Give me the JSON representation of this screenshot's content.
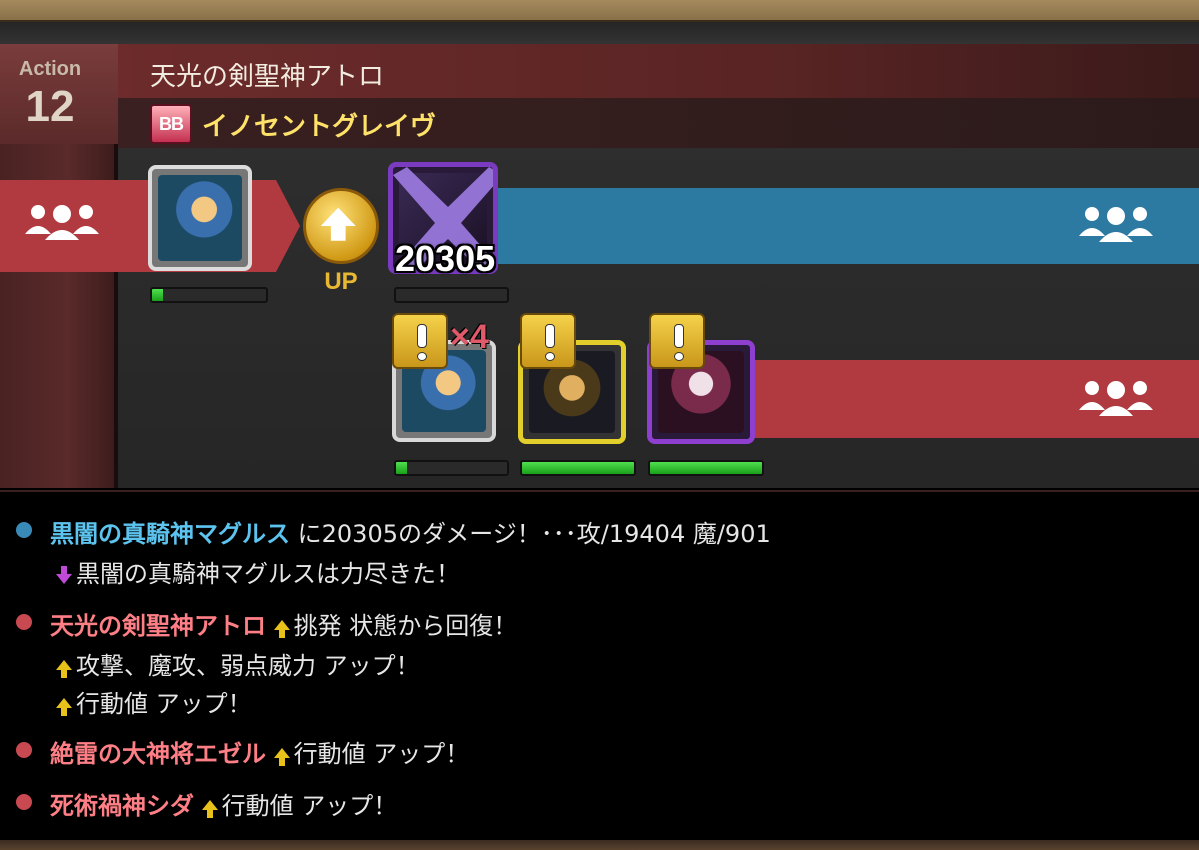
{
  "colors": {
    "ally_band": "#b03a40",
    "enemy_band": "#2c7aa1",
    "hp_fill": "#2fc02f",
    "ally_dot": "#c84a50",
    "enemy_dot": "#3a8ab8"
  },
  "header": {
    "action_label": "Action",
    "action_number": "12",
    "unit_name": "天光の剣聖神アトロ",
    "skill_badge": "BB",
    "skill_name": "イノセントグレイヴ"
  },
  "battle": {
    "up_label": "UP",
    "damage": "20305",
    "multiplier": "×4",
    "hp": {
      "actor": 0.1,
      "target": 0.0,
      "ally_a": 0.1,
      "ally_b": 1.0,
      "ally_c": 1.0
    },
    "icons": {
      "ally_group": "party-icon",
      "enemy_group": "party-icon",
      "up": "arrow-up-icon",
      "defeated": "x-mark-icon",
      "warning": "exclamation-icon"
    }
  },
  "log": [
    {
      "side": "enemy",
      "name": "黒闇の真騎神マグルス",
      "text": "に20305のダメージ！･･･攻/19404 魔/901",
      "sub": [
        {
          "arrow": "down",
          "text": "黒闇の真騎神マグルスは力尽きた！"
        }
      ]
    },
    {
      "side": "ally",
      "name": "天光の剣聖神アトロ",
      "arrow": "up",
      "text": "挑発 状態から回復！",
      "sub": [
        {
          "arrow": "up",
          "text": "攻撃、魔攻、弱点威力 アップ！"
        },
        {
          "arrow": "up",
          "text": "行動値 アップ！"
        }
      ]
    },
    {
      "side": "ally",
      "name": "絶雷の大神将エゼル",
      "arrow": "up",
      "text": "行動値 アップ！",
      "sub": []
    },
    {
      "side": "ally",
      "name": "死術禍神シダ",
      "arrow": "up",
      "text": "行動値 アップ！",
      "sub": []
    }
  ]
}
